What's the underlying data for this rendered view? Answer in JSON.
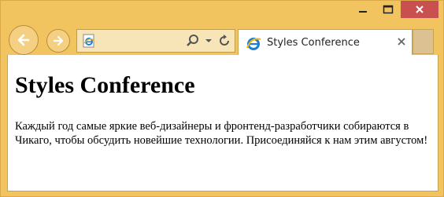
{
  "window": {
    "minimize_icon": "minimize-icon",
    "maximize_icon": "maximize-icon",
    "close_icon": "close-icon"
  },
  "nav": {
    "back_icon": "back-arrow-icon",
    "forward_icon": "forward-arrow-icon"
  },
  "address_bar": {
    "page_icon": "ie-logo-icon",
    "search_icon": "search-icon",
    "dropdown_icon": "chevron-down-icon",
    "refresh_icon": "refresh-icon"
  },
  "tab": {
    "title": "Styles Conference",
    "icon": "ie-logo-icon",
    "close_icon": "close-icon"
  },
  "page": {
    "heading": "Styles Conference",
    "paragraph": "Каждый год самые яркие веб-дизайнеры и фронтенд-разработчики собираются в Чикаго, чтобы обсудить новейшие технологии. Присоединяйся к нам этим августом!"
  },
  "colors": {
    "frame": "#f1c45f",
    "close_button": "#c8504f",
    "content_bg": "#ffffff"
  }
}
